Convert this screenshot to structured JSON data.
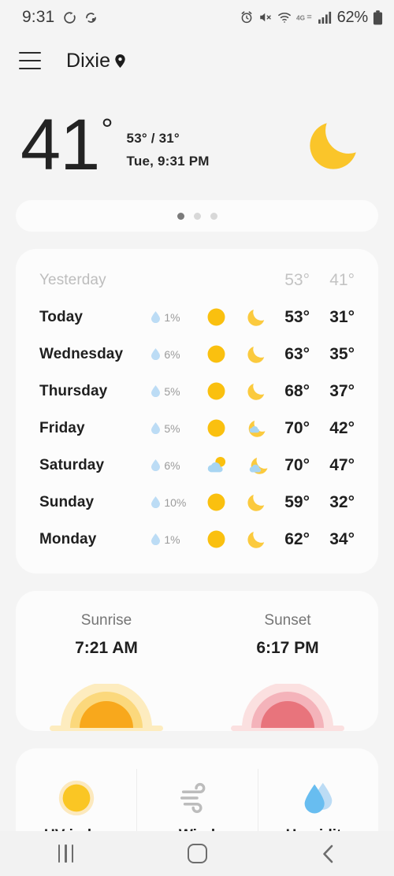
{
  "statusbar": {
    "time": "9:31",
    "battery": "62%",
    "network": "4G",
    "icons": [
      "rotate-icon",
      "sync-icon",
      "alarm-icon",
      "mute-icon",
      "wifi-icon",
      "network-4g-icon",
      "signal-icon",
      "battery-icon"
    ]
  },
  "appbar": {
    "menu": "menu-icon",
    "location": "Dixie",
    "location_pin": "location-pin-icon"
  },
  "hero": {
    "temperature": "41",
    "degree": "°",
    "high_low": "53° / 31°",
    "datetime": "Tue, 9:31 PM",
    "condition_icon": "moon-icon"
  },
  "pager": {
    "total": 3,
    "active": 0
  },
  "forecast": {
    "rows": [
      {
        "day": "Yesterday",
        "precip": "",
        "day_icon": "",
        "night_icon": "",
        "high": "53°",
        "low": "41°",
        "past": true
      },
      {
        "day": "Today",
        "precip": "1%",
        "day_icon": "sun-icon",
        "night_icon": "moon-icon",
        "high": "53°",
        "low": "31°",
        "past": false
      },
      {
        "day": "Wednesday",
        "precip": "6%",
        "day_icon": "sun-icon",
        "night_icon": "moon-icon",
        "high": "63°",
        "low": "35°",
        "past": false
      },
      {
        "day": "Thursday",
        "precip": "5%",
        "day_icon": "sun-icon",
        "night_icon": "moon-icon",
        "high": "68°",
        "low": "37°",
        "past": false
      },
      {
        "day": "Friday",
        "precip": "5%",
        "day_icon": "sun-icon",
        "night_icon": "moon-cloud-icon",
        "high": "70°",
        "low": "42°",
        "past": false
      },
      {
        "day": "Saturday",
        "precip": "6%",
        "day_icon": "sun-cloud-icon",
        "night_icon": "moon-cloud-icon",
        "high": "70°",
        "low": "47°",
        "past": false
      },
      {
        "day": "Sunday",
        "precip": "10%",
        "day_icon": "sun-icon",
        "night_icon": "moon-icon",
        "high": "59°",
        "low": "32°",
        "past": false
      },
      {
        "day": "Monday",
        "precip": "1%",
        "day_icon": "sun-icon",
        "night_icon": "moon-icon",
        "high": "62°",
        "low": "34°",
        "past": false
      }
    ]
  },
  "sun": {
    "sunrise_label": "Sunrise",
    "sunrise_time": "7:21 AM",
    "sunrise_icon": "sunrise-icon",
    "sunset_label": "Sunset",
    "sunset_time": "6:17 PM",
    "sunset_icon": "sunset-icon"
  },
  "metrics": [
    {
      "label": "UV index",
      "icon": "uv-sun-icon"
    },
    {
      "label": "Wind",
      "icon": "wind-icon"
    },
    {
      "label": "Humidity",
      "icon": "humidity-droplet-icon"
    }
  ],
  "navbar": {
    "recents": "recents-icon",
    "home": "home-icon",
    "back": "back-icon"
  },
  "colors": {
    "background": "#f4f4f4",
    "card": "#fcfcfc",
    "sun": "#fac00f",
    "moon": "#fbca3e",
    "cloud": "#a8d5f2",
    "droplet": "#bcdcf5",
    "text": "#1f1f1f",
    "muted": "#9b9b9b",
    "sunset": "#e8747c"
  }
}
